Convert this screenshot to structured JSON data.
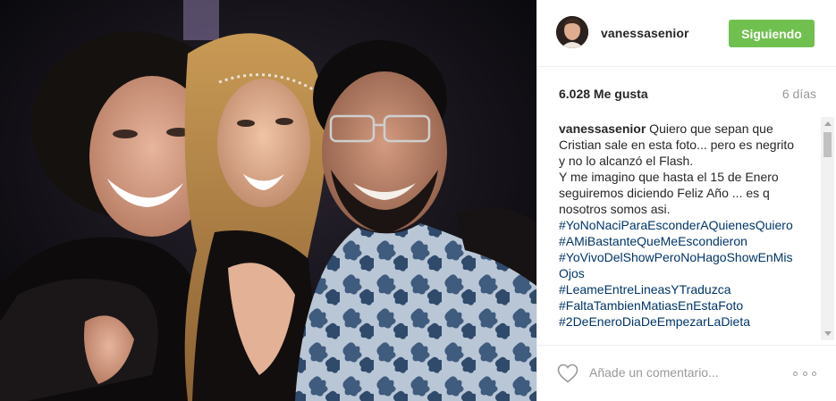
{
  "post": {
    "username": "vanessasenior",
    "follow_label": "Siguiendo",
    "likes": "6.028 Me gusta",
    "time_ago": "6 días",
    "caption_user": "vanessasenior",
    "caption_text": " Quiero que sepan que Cristian sale en esta foto... pero es negrito y no lo alcanzó el Flash.",
    "caption_text2": "Y me imagino que hasta el 15 de Enero seguiremos diciendo Feliz Año ... es q nosotros somos asi.",
    "hashtags": [
      "#YoNoNaciParaEsconderAQuienesQuiero",
      "#AMiBastanteQueMeEscondieron",
      "#YoVivoDelShowPeroNoHagoShowEnMisOjos",
      "#LeameEntreLineasYTraduzca",
      "#FaltaTambienMatiasEnEstaFoto",
      "#2DeEneroDiaDeEmpezarLaDieta"
    ],
    "comment_placeholder": "Añade un comentario...",
    "colors": {
      "follow_button": "#70c050",
      "hashtag": "#003569",
      "muted": "#999999"
    },
    "icons": [
      "heart-icon",
      "more-options-icon"
    ]
  }
}
